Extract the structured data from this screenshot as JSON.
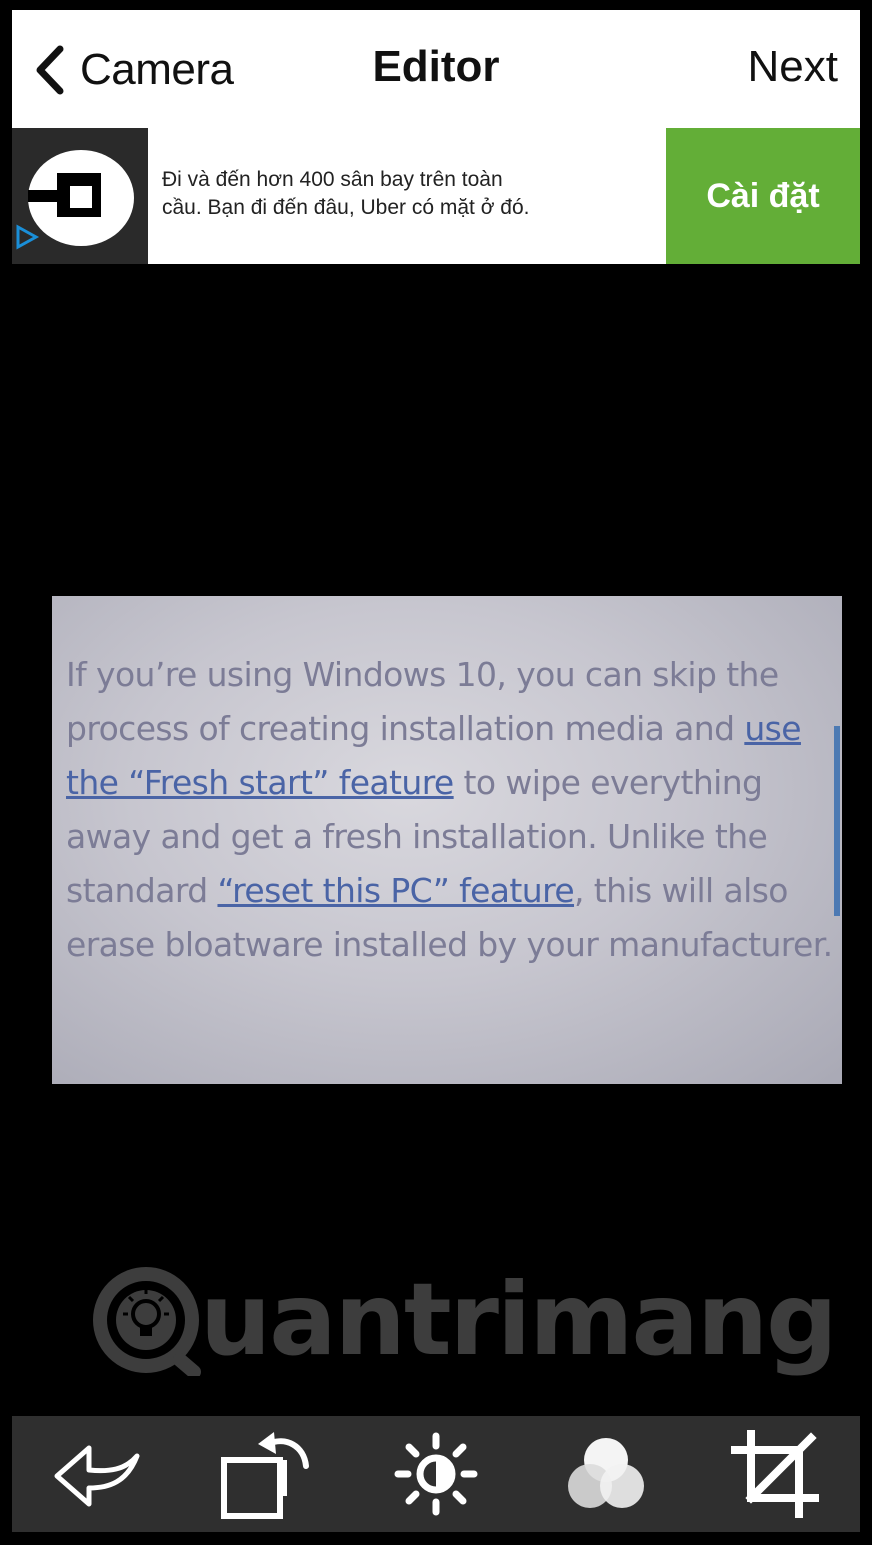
{
  "nav": {
    "back_label": "Camera",
    "title": "Editor",
    "next_label": "Next"
  },
  "ad": {
    "logo_icon": "uber-logo-icon",
    "adchoices_icon": "adchoices-icon",
    "line1": "Đi và đến hơn 400 sân bay trên toàn",
    "line2": "cầu. Bạn đi đến đâu, Uber có mặt ở đó.",
    "cta_label": "Cài đặt",
    "cta_color": "#63ae37"
  },
  "photo": {
    "segments": [
      "If you’re using Windows 10, you can skip the process of creating installation media and ",
      "use the “Fresh start” feature",
      " to wipe everything away and get a fresh installation. Unlike the standard ",
      "“reset this PC” feature",
      ", this will also erase bloatware installed by your manufacturer."
    ],
    "link_color": "#4a64a6"
  },
  "watermark": {
    "text": "uantrimang",
    "logo_icon": "quantrimang-logo-icon"
  },
  "toolbar": {
    "tools": [
      {
        "icon": "undo-arrow-icon"
      },
      {
        "icon": "rotate-icon"
      },
      {
        "icon": "brightness-icon"
      },
      {
        "icon": "filters-icon"
      },
      {
        "icon": "crop-icon"
      }
    ],
    "background": "#2f2f2f"
  }
}
